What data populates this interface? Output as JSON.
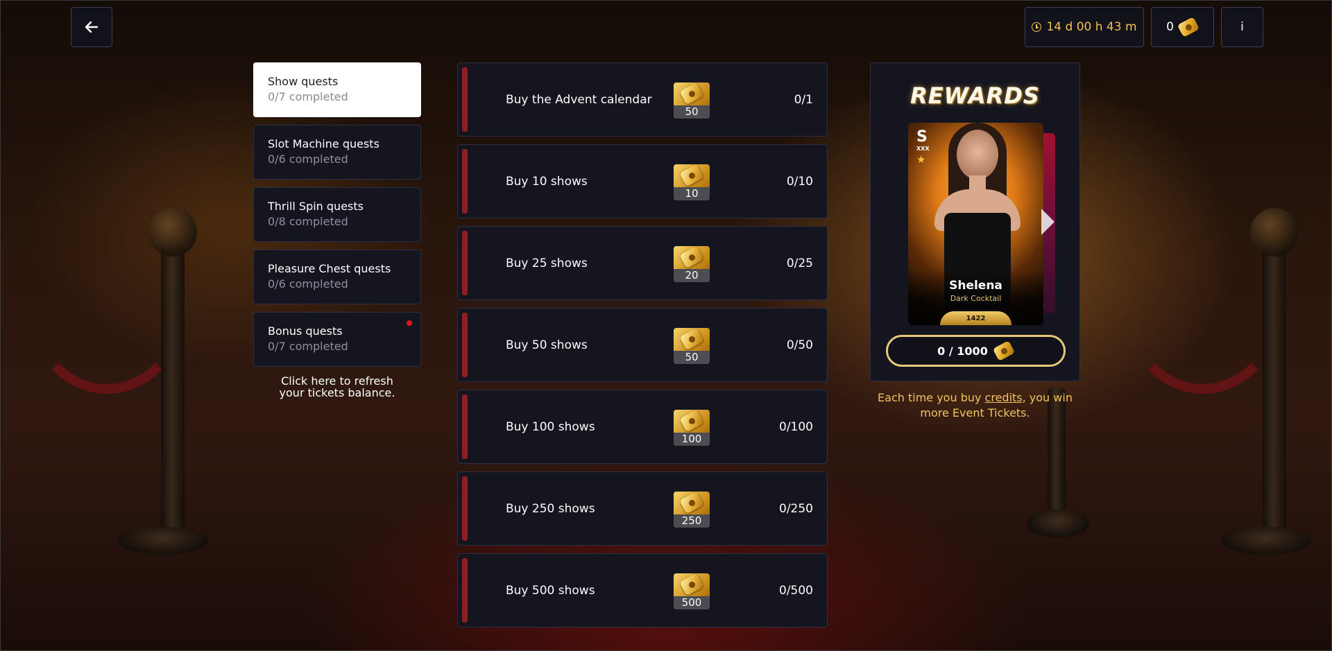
{
  "header": {
    "back_icon": "arrow-left-icon",
    "timer": "14 d 00 h 43 m",
    "tickets_balance": "0",
    "info_label": "i"
  },
  "sidebar": {
    "items": [
      {
        "title": "Show quests",
        "subtitle": "0/7 completed",
        "active": true
      },
      {
        "title": "Slot Machine quests",
        "subtitle": "0/6 completed"
      },
      {
        "title": "Thrill Spin quests",
        "subtitle": "0/8 completed"
      },
      {
        "title": "Pleasure Chest quests",
        "subtitle": "0/6 completed"
      },
      {
        "title": "Bonus quests",
        "subtitle": "0/7 completed",
        "notification_dot": true
      }
    ],
    "refresh_line1": "Click here to refresh",
    "refresh_line2": "your tickets balance."
  },
  "quests": [
    {
      "label": "Buy the Advent calendar",
      "reward": "50",
      "progress": "0/1"
    },
    {
      "label": "Buy 10 shows",
      "reward": "10",
      "progress": "0/10"
    },
    {
      "label": "Buy 25 shows",
      "reward": "20",
      "progress": "0/25"
    },
    {
      "label": "Buy 50 shows",
      "reward": "50",
      "progress": "0/50"
    },
    {
      "label": "Buy 100 shows",
      "reward": "100",
      "progress": "0/100"
    },
    {
      "label": "Buy 250 shows",
      "reward": "250",
      "progress": "0/250"
    },
    {
      "label": "Buy 500 shows",
      "reward": "500",
      "progress": "0/500"
    }
  ],
  "rewards": {
    "title": "REWARDS",
    "card": {
      "brand": "S",
      "brand_sub": "XXX",
      "name": "Shelena",
      "subtitle": "Dark Cocktail",
      "number": "1422"
    },
    "progress": "0 / 1000",
    "note_prefix": "Each time you buy ",
    "note_link": "credits",
    "note_suffix": ", you win more Event Tickets."
  },
  "colors": {
    "accent_gold": "#f1c45e",
    "panel_bg": "#15151f",
    "quest_bar": "#8e1f20",
    "notification": "#e01616"
  }
}
